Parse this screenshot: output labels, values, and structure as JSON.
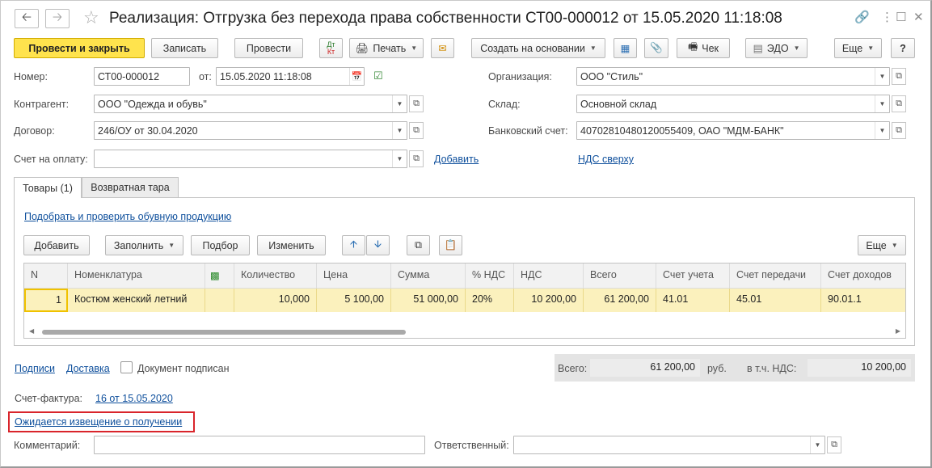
{
  "window": {
    "title": "Реализация: Отгрузка без перехода права собственности СТ00-000012 от 15.05.2020 11:18:08",
    "icons": [
      "link-icon",
      "more-icon",
      "maximize-icon",
      "close-icon"
    ]
  },
  "toolbar": {
    "post_close": "Провести и закрыть",
    "save": "Записать",
    "post": "Провести",
    "dtkt_top": "Дт",
    "dtkt_bottom": "Кт",
    "print": "Печать",
    "create_based": "Создать на основании",
    "receipt": "Чек",
    "edo": "ЭДО",
    "more": "Еще",
    "help": "?"
  },
  "form": {
    "number_label": "Номер:",
    "number_value": "СТ00-000012",
    "date_label": "от:",
    "date_value": "15.05.2020 11:18:08",
    "org_label": "Организация:",
    "org_value": "ООО \"Стиль\"",
    "counterparty_label": "Контрагент:",
    "counterparty_value": "ООО \"Одежда и обувь\"",
    "warehouse_label": "Склад:",
    "warehouse_value": "Основной склад",
    "contract_label": "Договор:",
    "contract_value": "246/ОУ от 30.04.2020",
    "bank_label": "Банковский счет:",
    "bank_value": "40702810480120055409, ОАО \"МДМ-БАНК\"",
    "invoice_label": "Счет на оплату:",
    "invoice_value": "",
    "add_link": "Добавить",
    "vat_link": "НДС сверху"
  },
  "tabs": [
    {
      "label": "Товары (1)",
      "active": true
    },
    {
      "label": "Возвратная тара",
      "active": false
    }
  ],
  "goods": {
    "shoes_link": "Подобрать и проверить обувную продукцию",
    "add": "Добавить",
    "fill": "Заполнить",
    "pick": "Подбор",
    "change": "Изменить",
    "more": "Еще",
    "columns": [
      "N",
      "Номенклатура",
      "",
      "Количество",
      "Цена",
      "Сумма",
      "% НДС",
      "НДС",
      "Всего",
      "Счет учета",
      "Счет передачи",
      "Счет доходов"
    ],
    "rows": [
      [
        "1",
        "Костюм женский летний",
        "",
        "10,000",
        "5 100,00",
        "51 000,00",
        "20%",
        "10 200,00",
        "61 200,00",
        "41.01",
        "45.01",
        "90.01.1"
      ]
    ]
  },
  "footer": {
    "signatures": "Подписи",
    "delivery": "Доставка",
    "signed_label": "Документ подписан",
    "total_label": "Всего:",
    "total_value": "61 200,00",
    "currency": "руб.",
    "vat_label": "в т.ч. НДС:",
    "vat_value": "10 200,00",
    "invoice_label": "Счет-фактура:",
    "invoice_link": "16 от 15.05.2020",
    "notice_link": "Ожидается извещение о получении",
    "comment_label": "Комментарий:",
    "comment_value": "",
    "responsible_label": "Ответственный:",
    "responsible_value": ""
  },
  "colors": {
    "primary_button": "#ffe34d",
    "link": "#0e4f9c",
    "selected_row": "#fbf1bd",
    "highlight_border": "#d9252b"
  }
}
